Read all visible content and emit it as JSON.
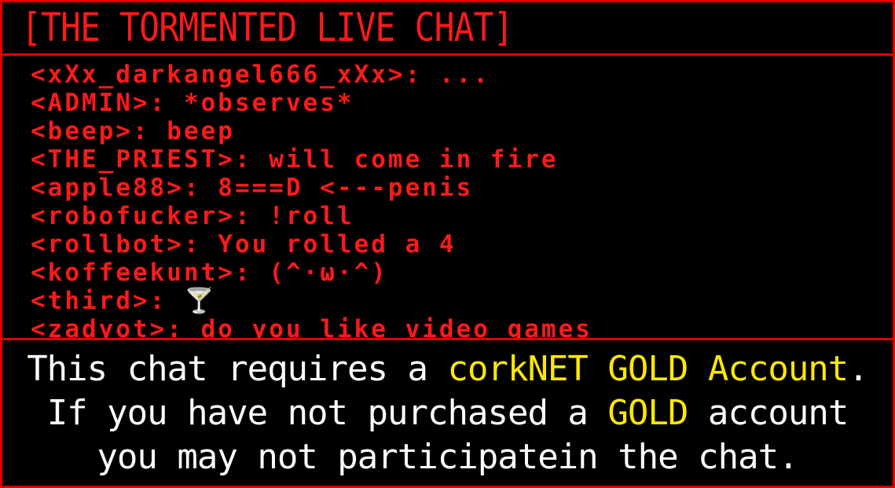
{
  "title": "[THE TORMENTED LIVE CHAT]",
  "chat": [
    "<xXx_darkangel666_xXx>: ...",
    "<ADMIN>: *observes*",
    "<beep>: beep",
    "<THE_PRIEST>: will come in fire",
    "<apple88>: 8===D <---penis",
    "<robofucker>: !roll",
    "<rollbot>: You rolled a 4",
    "<koffeekunt>: (^·ω·^)",
    "<third>: 🍸",
    "<zadyot>: do you like video games"
  ],
  "notice": {
    "line1_pre": "This chat requires a ",
    "line1_gold": "corkNET GOLD Account",
    "line1_post": ".",
    "line2_pre": "If you have not purchased a ",
    "line2_gold": "GOLD",
    "line2_post": " account",
    "line3": "you may not participatein the chat."
  },
  "colors": {
    "chat_red": "#ff1a1a",
    "border_red": "#e00000",
    "gold": "#ffe800",
    "notice_white": "#ffffff",
    "background": "#000000"
  }
}
